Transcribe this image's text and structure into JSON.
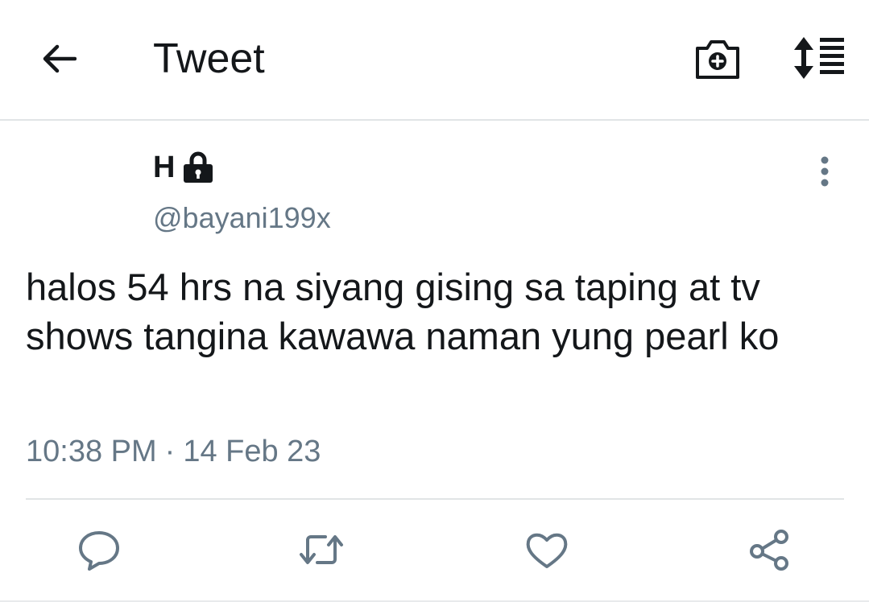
{
  "header": {
    "title": "Tweet",
    "back_icon": "arrow-left-icon",
    "camera_icon": "add-photo-icon",
    "sort_icon": "sort-list-icon"
  },
  "tweet": {
    "name": "H",
    "protected_icon": "lock-icon",
    "handle": "@bayani199x",
    "text": "halos 54 hrs na siyang gising sa taping at tv shows tangina kawawa naman yung pearl ko",
    "time": "10:38 PM",
    "separator": "·",
    "date": "14 Feb 23"
  },
  "actions": [
    "reply-icon",
    "retweet-icon",
    "like-icon",
    "share-icon"
  ],
  "colors": {
    "text_primary": "#14171a",
    "text_secondary": "#657786",
    "icon_gray": "#657786",
    "divider": "#e1e4e6",
    "background": "#ffffff"
  }
}
